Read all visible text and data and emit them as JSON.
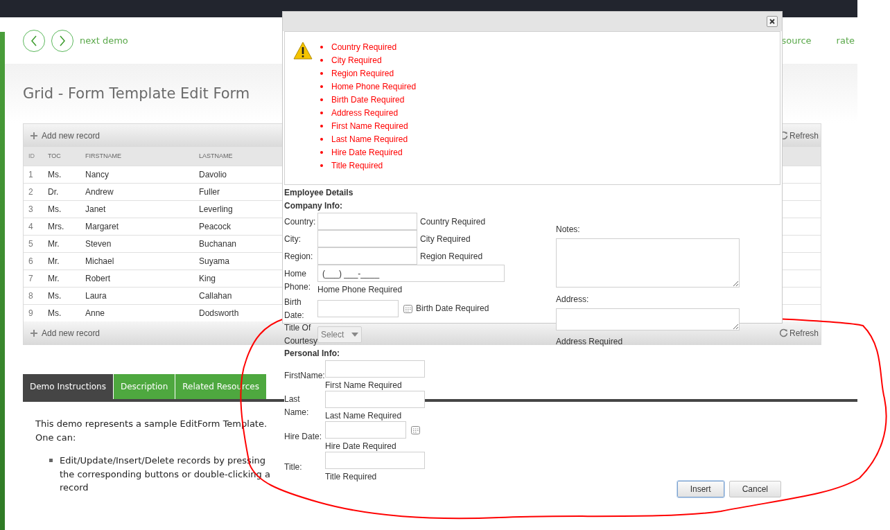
{
  "header": {
    "nav_link": "next demo",
    "links": [
      "source",
      "rate"
    ]
  },
  "page_title": "Grid - Form Template Edit Form",
  "grid": {
    "toolbar": {
      "add": "Add new record",
      "refresh": "Refresh"
    },
    "columns": [
      "ID",
      "TOC",
      "FIRSTNAME",
      "LASTNAME"
    ],
    "rows": [
      [
        "1",
        "Ms.",
        "Nancy",
        "Davolio"
      ],
      [
        "2",
        "Dr.",
        "Andrew",
        "Fuller"
      ],
      [
        "3",
        "Ms.",
        "Janet",
        "Leverling"
      ],
      [
        "4",
        "Mrs.",
        "Margaret",
        "Peacock"
      ],
      [
        "5",
        "Mr.",
        "Steven",
        "Buchanan"
      ],
      [
        "6",
        "Mr.",
        "Michael",
        "Suyama"
      ],
      [
        "7",
        "Mr.",
        "Robert",
        "King"
      ],
      [
        "8",
        "Ms.",
        "Laura",
        "Callahan"
      ],
      [
        "9",
        "Ms.",
        "Anne",
        "Dodsworth"
      ]
    ],
    "footer": {
      "add": "Add new record",
      "refresh": "Refresh"
    }
  },
  "tabs": [
    {
      "label": "Demo Instructions",
      "selected": true
    },
    {
      "label": "Description",
      "selected": false
    },
    {
      "label": "Related Resources",
      "selected": false
    }
  ],
  "instructions": {
    "intro": "This demo represents a sample EditForm Template. One can:",
    "bullets": [
      "Edit/Update/Insert/Delete records by pressing the corresponding buttons or double-clicking a record"
    ]
  },
  "dialog": {
    "errors": [
      "Country Required",
      "City Required",
      "Region Required",
      "Home Phone Required",
      "Birth Date Required",
      "Address Required",
      "First Name Required",
      "Last Name Required",
      "Hire Date Required",
      "Title Required"
    ],
    "form": {
      "title": "Employee Details",
      "company_heading": "Company Info:",
      "company_fields": [
        {
          "kind": "text",
          "label": "Country:",
          "message": "Country Required"
        },
        {
          "kind": "text",
          "label": "City:",
          "message": "City Required"
        },
        {
          "kind": "text",
          "label": "Region:",
          "message": "Region Required"
        },
        {
          "kind": "masked",
          "label": "Home Phone:",
          "value": "(___) ___-____",
          "message": "Home Phone Required"
        },
        {
          "kind": "date",
          "label": "Birth Date:",
          "message": "Birth Date Required"
        },
        {
          "kind": "select",
          "label": "Title Of Courtesy",
          "value": "Select"
        }
      ],
      "side_fields": [
        {
          "kind": "textarea",
          "label": "Notes:"
        },
        {
          "kind": "textarea",
          "label": "Address:",
          "message": "Address Required"
        }
      ],
      "personal_heading": "Personal Info:",
      "personal_fields": [
        {
          "kind": "text",
          "label": "FirstName:",
          "message": "First Name Required"
        },
        {
          "kind": "text",
          "label": "Last Name:",
          "message": "Last Name Required"
        },
        {
          "kind": "date",
          "label": "Hire Date:",
          "message": "Hire Date Required"
        },
        {
          "kind": "text",
          "label": "Title:",
          "message": "Title Required"
        }
      ],
      "buttons": [
        {
          "label": "Insert",
          "focused": true
        },
        {
          "label": "Cancel",
          "focused": false
        }
      ]
    }
  }
}
